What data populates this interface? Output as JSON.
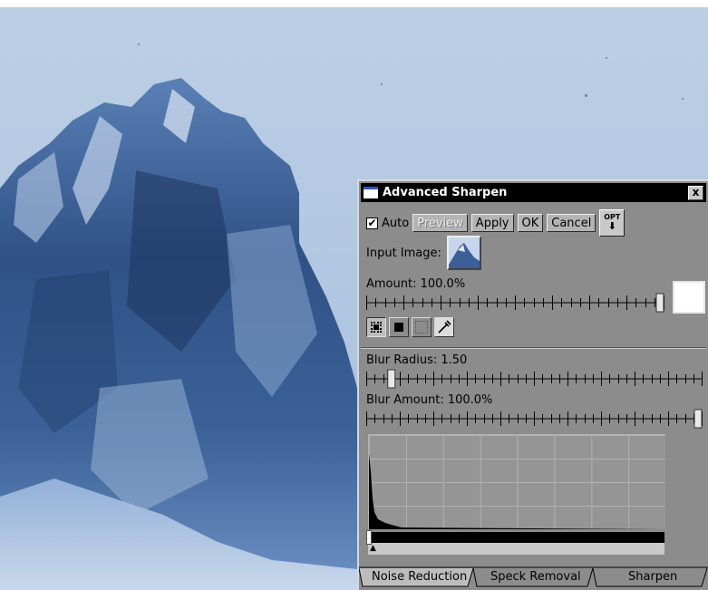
{
  "dialog": {
    "title": "Advanced Sharpen",
    "close_label": "x",
    "auto_label": "Auto",
    "auto_checked": true,
    "buttons": {
      "preview": "Preview",
      "apply": "Apply",
      "ok": "OK",
      "cancel": "Cancel",
      "opt": "OPT"
    },
    "input_image_label": "Input Image:",
    "amount_label": "Amount: 100.0%",
    "amount_value": 100.0,
    "blur_radius_label": "Blur Radius: 1.50",
    "blur_radius_value": 1.5,
    "blur_amount_label": "Blur Amount: 100.0%",
    "blur_amount_value": 100.0,
    "tabs": [
      "Noise Reduction",
      "Speck Removal",
      "Sharpen"
    ],
    "active_tab": "Noise Reduction"
  },
  "colors": {
    "dialog_bg": "#8c8c8c",
    "titlebar_bg": "#000000",
    "sky": "#b3c8e2",
    "rock_dark": "#233c68"
  },
  "icons": {
    "window": "window-icon",
    "close": "close-icon",
    "opt": "opt-arrow-icon",
    "eyedropper": "eyedropper-icon"
  }
}
